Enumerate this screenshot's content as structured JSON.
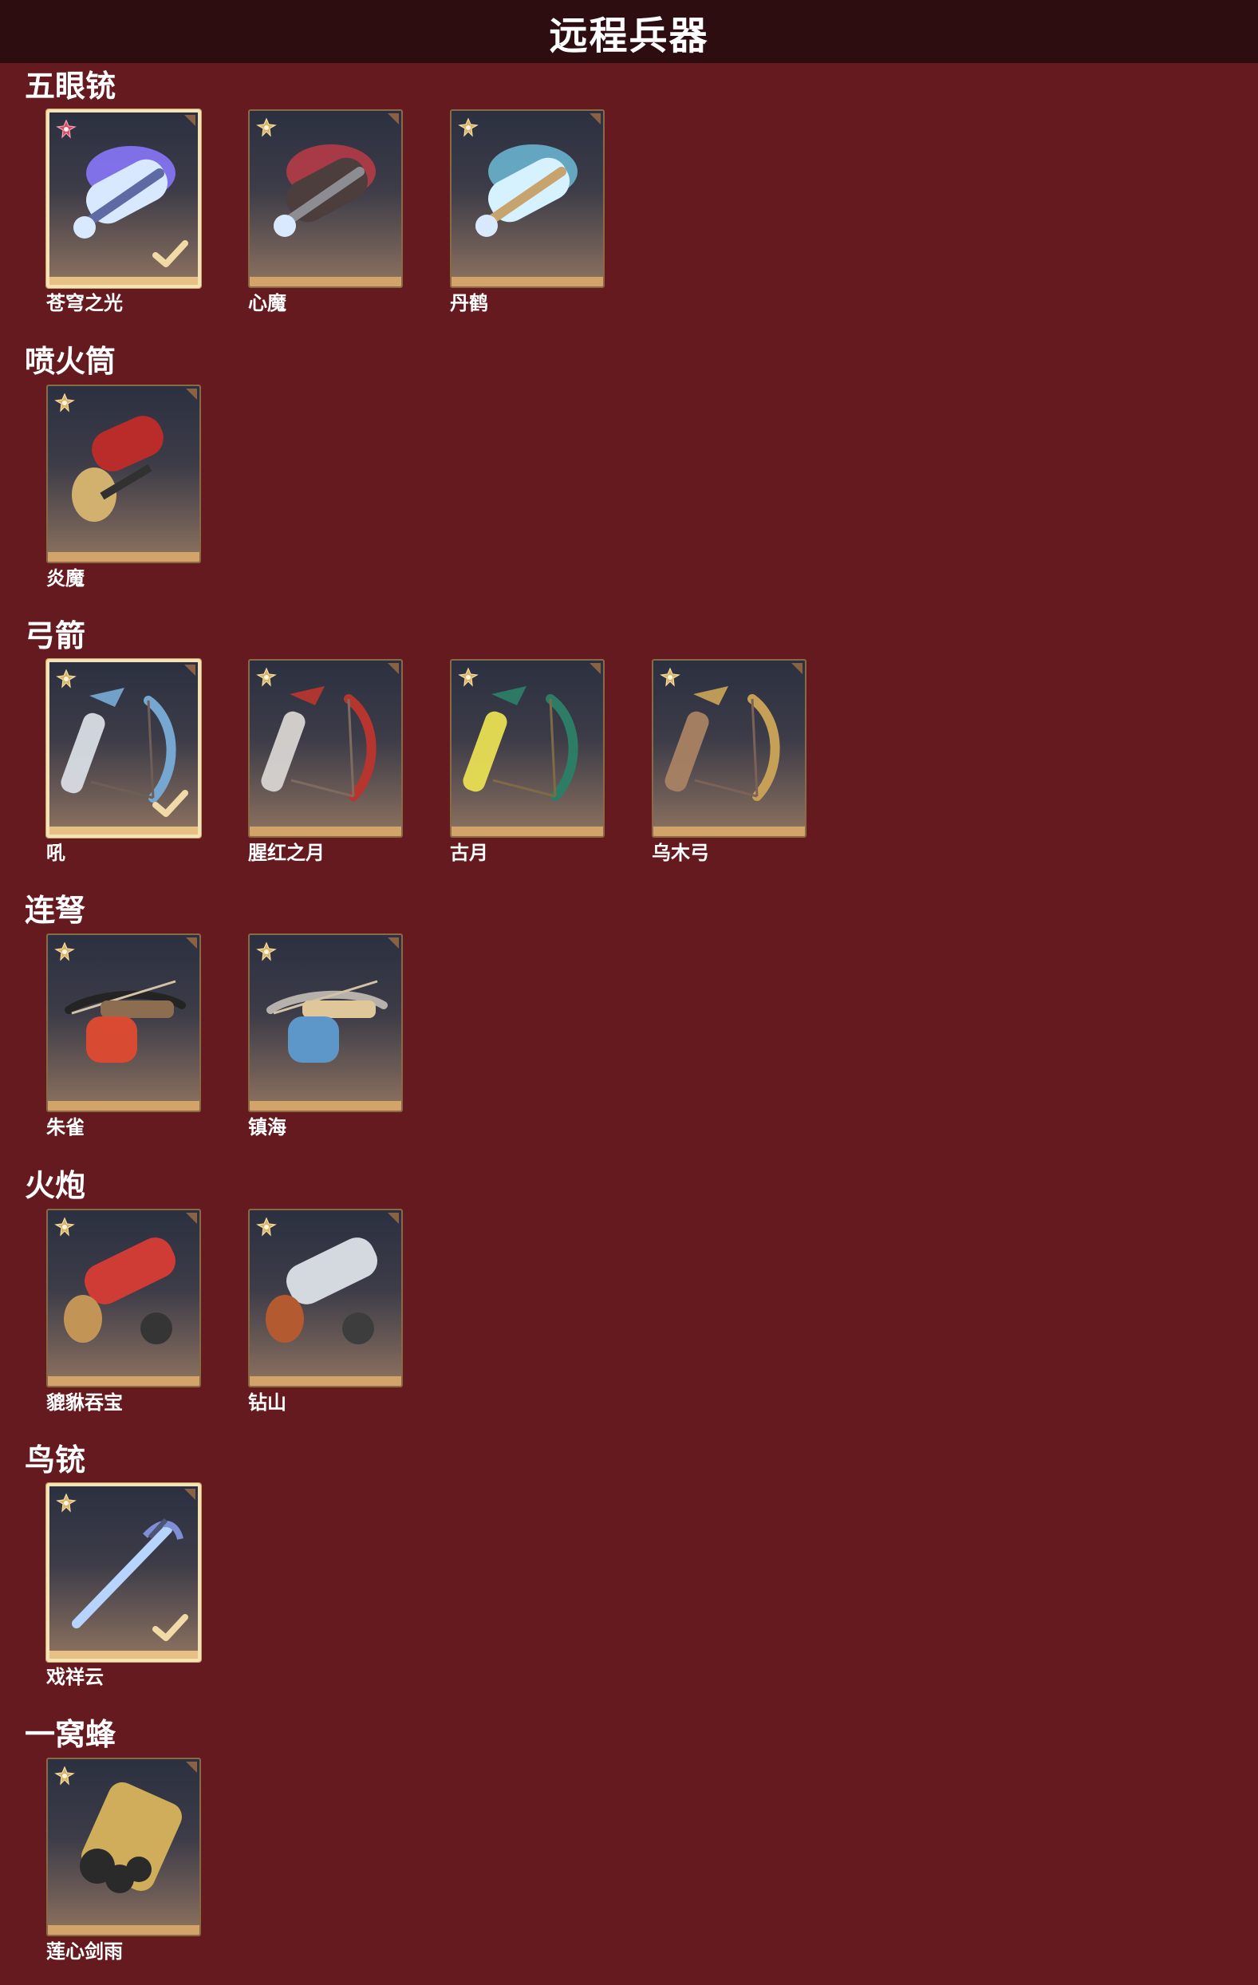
{
  "header": {
    "title": "远程兵器"
  },
  "sections": [
    {
      "title": "五眼铳",
      "items": [
        {
          "label": "苍穹之光",
          "selected": true,
          "rank_icon": "red-flower-icon",
          "art_icon": "five-barrel-gun-icon"
        },
        {
          "label": "心魔",
          "selected": false,
          "rank_icon": "gold-flower-icon",
          "art_icon": "five-barrel-gun-icon"
        },
        {
          "label": "丹鹤",
          "selected": false,
          "rank_icon": "gold-flower-icon",
          "art_icon": "five-barrel-gun-icon"
        }
      ]
    },
    {
      "title": "喷火筒",
      "items": [
        {
          "label": "炎魔",
          "selected": false,
          "rank_icon": "gold-flower-icon",
          "art_icon": "flame-tube-icon"
        }
      ]
    },
    {
      "title": "弓箭",
      "items": [
        {
          "label": "吼",
          "selected": true,
          "rank_icon": "gold-flower-icon",
          "art_icon": "bow-and-quiver-icon"
        },
        {
          "label": "腥红之月",
          "selected": false,
          "rank_icon": "gold-flower-icon",
          "art_icon": "bow-and-quiver-icon"
        },
        {
          "label": "古月",
          "selected": false,
          "rank_icon": "gold-flower-icon",
          "art_icon": "bow-and-quiver-icon"
        },
        {
          "label": "乌木弓",
          "selected": false,
          "rank_icon": "gold-flower-icon",
          "art_icon": "bow-and-quiver-icon"
        }
      ]
    },
    {
      "title": "连弩",
      "items": [
        {
          "label": "朱雀",
          "selected": false,
          "rank_icon": "gold-flower-icon",
          "art_icon": "crossbow-icon"
        },
        {
          "label": "镇海",
          "selected": false,
          "rank_icon": "gold-flower-icon",
          "art_icon": "crossbow-icon"
        }
      ]
    },
    {
      "title": "火炮",
      "items": [
        {
          "label": "貔貅吞宝",
          "selected": false,
          "rank_icon": "gold-flower-icon",
          "art_icon": "cannon-icon"
        },
        {
          "label": "钻山",
          "selected": false,
          "rank_icon": "gold-flower-icon",
          "art_icon": "cannon-icon"
        }
      ]
    },
    {
      "title": "鸟铳",
      "items": [
        {
          "label": "戏祥云",
          "selected": true,
          "rank_icon": "gold-flower-icon",
          "art_icon": "musket-icon"
        }
      ]
    },
    {
      "title": "一窝蜂",
      "items": [
        {
          "label": "莲心剑雨",
          "selected": false,
          "rank_icon": "gold-flower-icon",
          "art_icon": "rocket-launcher-icon"
        }
      ]
    }
  ],
  "colors": {
    "background": "#641a1e",
    "header_bar": "#2d0d0f",
    "card_border": "#8a6a45",
    "card_accent": "#d2a46a",
    "selected_border": "#f3e3b6",
    "rank_gold": "#d7b26a",
    "rank_red": "#d84a61"
  }
}
